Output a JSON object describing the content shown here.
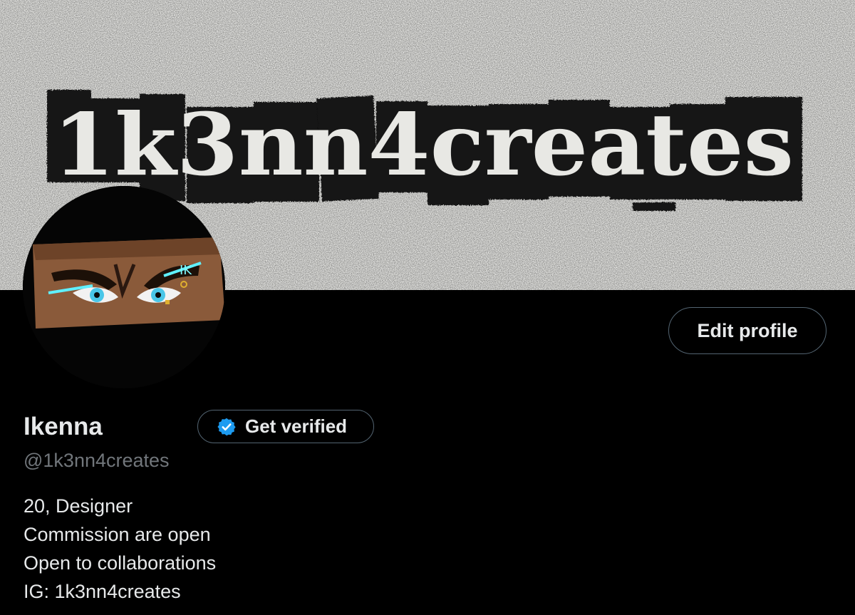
{
  "banner": {
    "logo_text": "1k3nn4creates",
    "background_color": "#e9e9e6",
    "ink_color": "#111111"
  },
  "avatar": {
    "description_icon": "ninja-eyes-avatar"
  },
  "profile": {
    "edit_profile_label": "Edit profile",
    "display_name": "Ikenna",
    "get_verified_label": "Get verified",
    "verified_badge_color": "#1d9bf0",
    "handle": "@1k3nn4creates",
    "bio_lines": [
      "20, Designer",
      "Commission are open",
      "Open to collaborations",
      "IG: 1k3nn4creates"
    ]
  }
}
